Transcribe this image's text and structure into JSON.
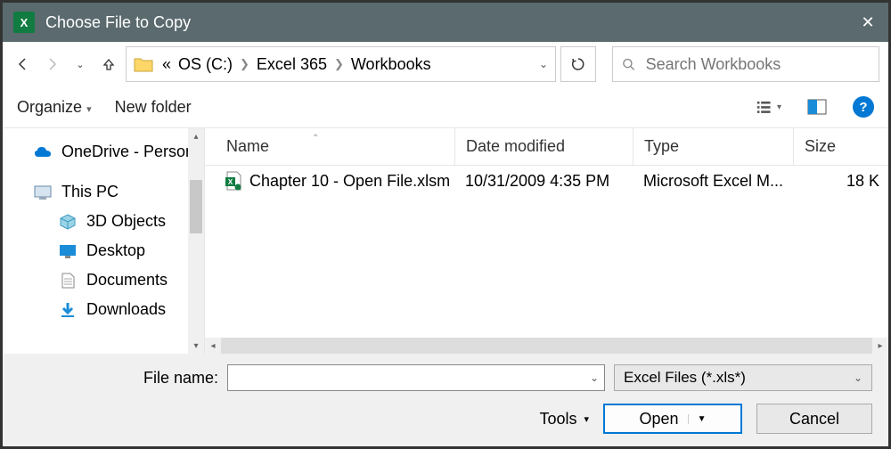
{
  "title": "Choose File to Copy",
  "breadcrumb": {
    "prefix": "«",
    "parts": [
      "OS (C:)",
      "Excel 365",
      "Workbooks"
    ]
  },
  "search": {
    "placeholder": "Search Workbooks"
  },
  "toolbar": {
    "organize": "Organize",
    "newfolder": "New folder"
  },
  "nav": {
    "items": [
      {
        "label": "OneDrive - Person",
        "icon": "cloud"
      },
      {
        "label": "This PC",
        "icon": "pc"
      },
      {
        "label": "3D Objects",
        "icon": "3d",
        "sub": true
      },
      {
        "label": "Desktop",
        "icon": "desktop",
        "sub": true
      },
      {
        "label": "Documents",
        "icon": "doc",
        "sub": true
      },
      {
        "label": "Downloads",
        "icon": "dl",
        "sub": true
      }
    ]
  },
  "columns": {
    "name": "Name",
    "date": "Date modified",
    "type": "Type",
    "size": "Size"
  },
  "files": [
    {
      "name": "Chapter 10 - Open File.xlsm",
      "date": "10/31/2009 4:35 PM",
      "type": "Microsoft Excel M...",
      "size": "18 K"
    }
  ],
  "filename": {
    "label": "File name:",
    "value": ""
  },
  "filter": "Excel Files (*.xls*)",
  "buttons": {
    "tools": "Tools",
    "open": "Open",
    "cancel": "Cancel"
  }
}
